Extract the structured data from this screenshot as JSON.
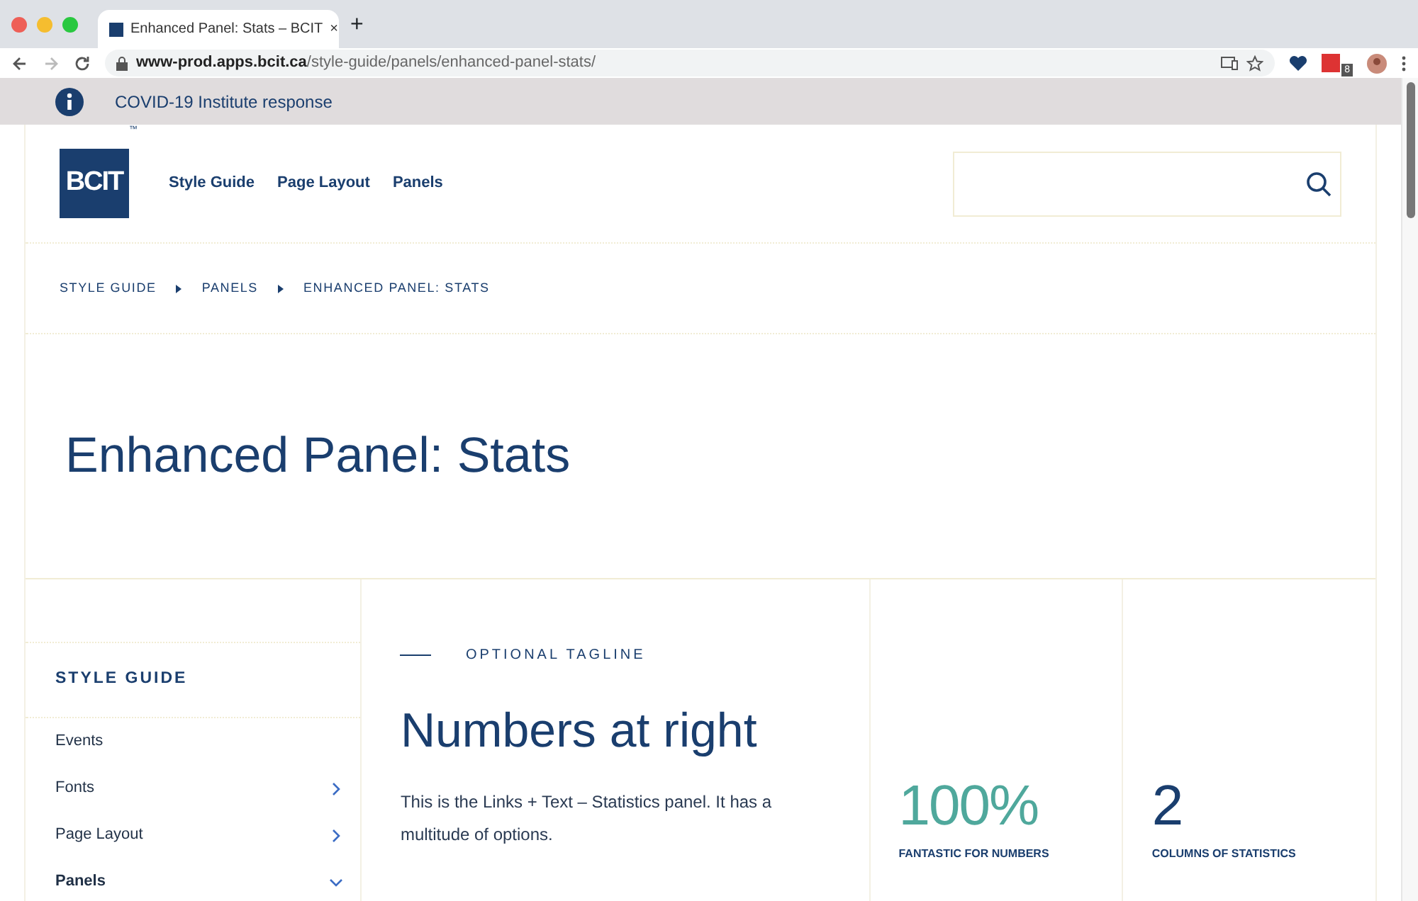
{
  "browser": {
    "tab": {
      "title": "Enhanced Panel: Stats – BCIT",
      "close": "×"
    },
    "new_tab": "+",
    "address": {
      "host": "www-prod.apps.bcit.ca",
      "path": "/style-guide/panels/enhanced-panel-stats/"
    },
    "extension_badge": "8"
  },
  "alert": {
    "text": "COVID-19 Institute response"
  },
  "header": {
    "logo": "BCIT",
    "trademark": "™",
    "nav": [
      "Style Guide",
      "Page Layout",
      "Panels"
    ]
  },
  "breadcrumb": [
    "STYLE GUIDE",
    "PANELS",
    "ENHANCED PANEL: STATS"
  ],
  "title": "Enhanced Panel: Stats",
  "sidebar": {
    "heading": "STYLE GUIDE",
    "items": [
      {
        "label": "Events",
        "kind": "link"
      },
      {
        "label": "Fonts",
        "kind": "group",
        "expanded": false
      },
      {
        "label": "Page Layout",
        "kind": "group",
        "expanded": false
      },
      {
        "label": "Panels",
        "kind": "group",
        "expanded": true
      }
    ]
  },
  "panel": {
    "tagline": "OPTIONAL TAGLINE",
    "heading": "Numbers at right",
    "body": "This is the Links + Text – Statistics panel. It has a multitude of options."
  },
  "stats": [
    {
      "value": "100%",
      "label": "FANTASTIC FOR NUMBERS",
      "color": "#4fa89c"
    },
    {
      "value": "2",
      "label": "COLUMNS OF STATISTICS",
      "color": "#1a3e6e"
    }
  ]
}
